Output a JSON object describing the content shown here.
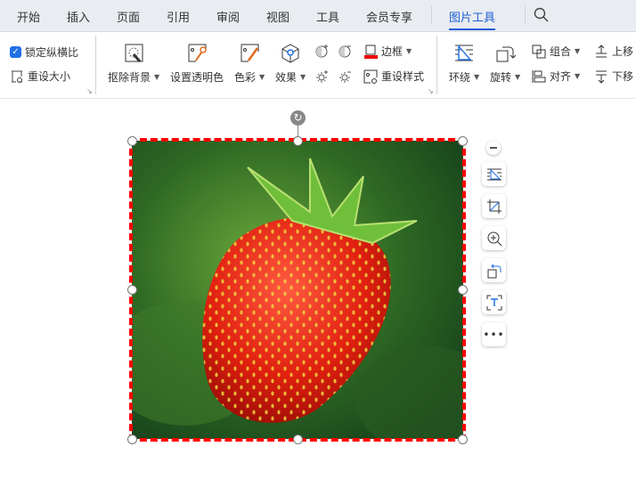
{
  "tabs": [
    {
      "label": "开始"
    },
    {
      "label": "插入"
    },
    {
      "label": "页面"
    },
    {
      "label": "引用"
    },
    {
      "label": "审阅"
    },
    {
      "label": "视图"
    },
    {
      "label": "工具"
    },
    {
      "label": "会员专享"
    },
    {
      "label": "图片工具",
      "active": true
    }
  ],
  "ribbon": {
    "lock_ratio": {
      "label": "锁定纵横比",
      "checked": true
    },
    "reset_size": "重设大小",
    "remove_bg": "抠除背景",
    "set_transparent": "设置透明色",
    "color": "色彩",
    "effect": "效果",
    "border": "边框",
    "reset_style": "重设样式",
    "wrap": "环绕",
    "rotate": "旋转",
    "group": "组合",
    "align": "对齐",
    "move_up": "上移",
    "move_down": "下移"
  },
  "colors": {
    "accent": "#1f5fd6",
    "border_red": "#ff0000"
  }
}
